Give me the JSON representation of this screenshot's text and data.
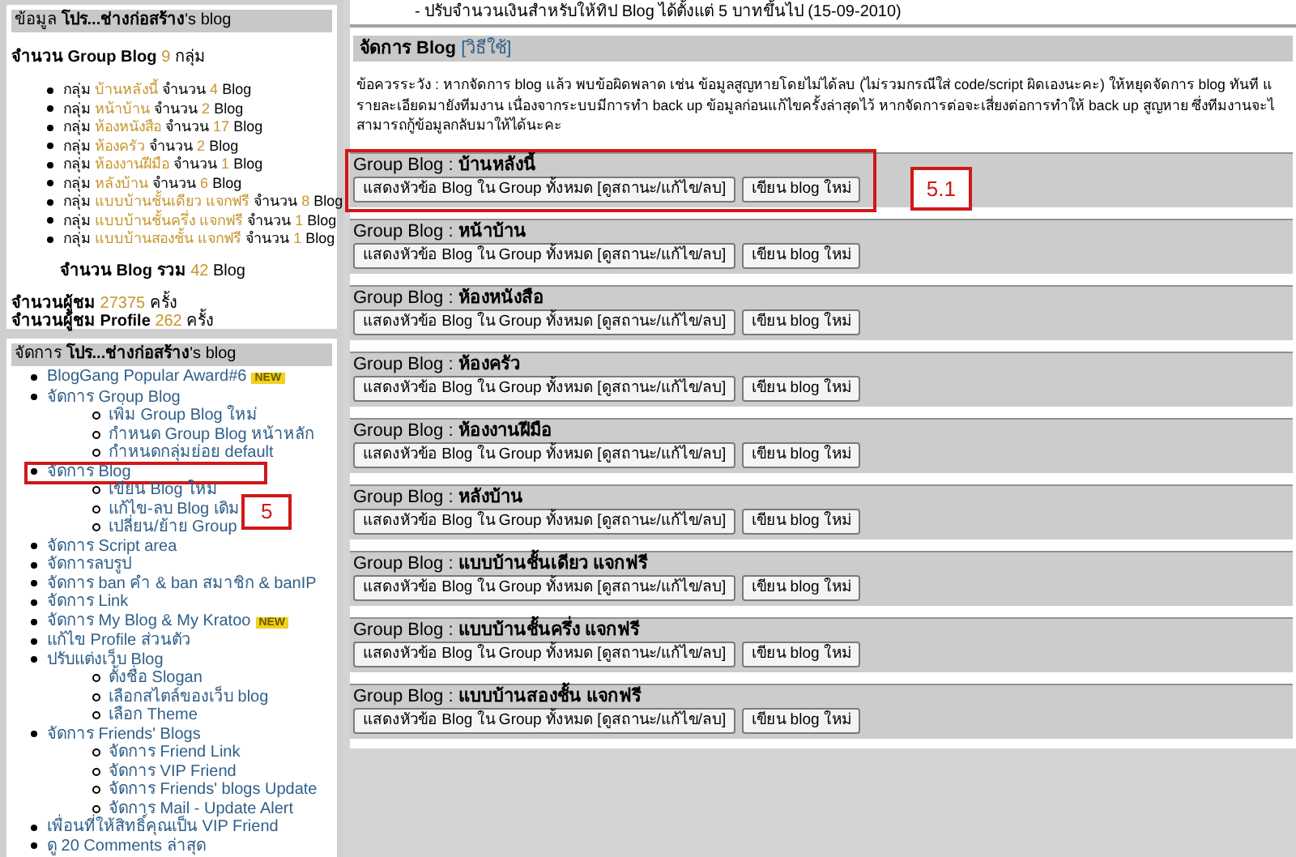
{
  "notice": "- ปรับจำนวนเงินสำหรับให้ทิป Blog ได้ตั้งแต่ 5 บาทขึ้นไป (15-09-2010)",
  "info": {
    "title_prefix": "ข้อมูล",
    "title_name": "โปร...ช่างก่อสร้าง",
    "title_suffix": "'s blog",
    "group_count_label": "จำนวน Group Blog",
    "group_count": "9",
    "group_count_unit": "กลุ่ม",
    "groups": [
      {
        "prefix": "กลุ่ม",
        "name": "บ้านหลังนี้",
        "count_label": "จำนวน",
        "count": "4",
        "unit": "Blog"
      },
      {
        "prefix": "กลุ่ม",
        "name": "หน้าบ้าน",
        "count_label": "จำนวน",
        "count": "2",
        "unit": "Blog"
      },
      {
        "prefix": "กลุ่ม",
        "name": "ห้องหนังสือ",
        "count_label": "จำนวน",
        "count": "17",
        "unit": "Blog"
      },
      {
        "prefix": "กลุ่ม",
        "name": "ห้องครัว",
        "count_label": "จำนวน",
        "count": "2",
        "unit": "Blog"
      },
      {
        "prefix": "กลุ่ม",
        "name": "ห้องงานฝีมือ",
        "count_label": "จำนวน",
        "count": "1",
        "unit": "Blog"
      },
      {
        "prefix": "กลุ่ม",
        "name": "หลังบ้าน",
        "count_label": "จำนวน",
        "count": "6",
        "unit": "Blog"
      },
      {
        "prefix": "กลุ่ม",
        "name": "แบบบ้านชั้นเดียว แจกฟรี",
        "count_label": "จำนวน",
        "count": "8",
        "unit": "Blog"
      },
      {
        "prefix": "กลุ่ม",
        "name": "แบบบ้านชั้นครึ่ง แจกฟรี",
        "count_label": "จำนวน",
        "count": "1",
        "unit": "Blog"
      },
      {
        "prefix": "กลุ่ม",
        "name": "แบบบ้านสองชั้น แจกฟรี",
        "count_label": "จำนวน",
        "count": "1",
        "unit": "Blog"
      }
    ],
    "total_label": "จำนวน Blog รวม",
    "total": "42",
    "total_unit": "Blog",
    "stats": [
      {
        "label": "จำนวนผู้ชม",
        "value": "27375",
        "unit": "ครั้ง"
      },
      {
        "label": "จำนวนผู้ชม Profile",
        "value": "262",
        "unit": "ครั้ง"
      }
    ]
  },
  "manage": {
    "title_prefix": "จัดการ",
    "title_name": "โปร...ช่างก่อสร้าง",
    "title_suffix": "'s blog",
    "items": [
      {
        "label": "BlogGang Popular Award#6",
        "badge": "NEW"
      },
      {
        "label": "จัดการ Group Blog",
        "children": [
          {
            "label": "เพิ่ม Group Blog ใหม่"
          },
          {
            "label": "กำหนด Group Blog หน้าหลัก"
          },
          {
            "label": "กำหนดกลุ่มย่อย default"
          }
        ]
      },
      {
        "label": "จัดการ Blog",
        "annotation": "5",
        "children": [
          {
            "label": "เขียน Blog ใหม่"
          },
          {
            "label": "แก้ไข-ลบ Blog เดิม"
          },
          {
            "label": "เปลี่ยน/ย้าย Group"
          }
        ]
      },
      {
        "label": "จัดการ Script area"
      },
      {
        "label": "จัดการลบรูป"
      },
      {
        "label": "จัดการ ban คำ & ban สมาชิก & banIP"
      },
      {
        "label": "จัดการ Link"
      },
      {
        "label": "จัดการ My Blog & My Kratoo",
        "badge": "NEW"
      },
      {
        "label": "แก้ไข Profile ส่วนตัว"
      },
      {
        "label": "ปรับแต่งเว็บ Blog",
        "children": [
          {
            "label": "ตั้งชื่อ Slogan"
          },
          {
            "label": "เลือกสไตล์ของเว็บ blog"
          },
          {
            "label": "เลือก Theme"
          }
        ]
      },
      {
        "label": "จัดการ Friends' Blogs",
        "children": [
          {
            "label": "จัดการ Friend Link"
          },
          {
            "label": "จัดการ VIP Friend"
          },
          {
            "label": "จัดการ Friends' blogs Update"
          },
          {
            "label": "จัดการ Mail - Update Alert"
          }
        ]
      },
      {
        "label": "เพื่อนที่ให้สิทธิ์คุณเป็น VIP Friend"
      },
      {
        "label": "ดู 20 Comments ล่าสุด"
      }
    ]
  },
  "blog_panel": {
    "title": "จัดการ Blog",
    "help_link": "[วิธีใช้]",
    "warning_lines": [
      "ข้อควรระวัง : หากจัดการ blog แล้ว พบข้อผิดพลาด เช่น ข้อมูลสูญหายโดยไม่ได้ลบ (ไม่รวมกรณีใส่ code/script ผิดเองนะคะ) ให้หยุดจัดการ blog ทันที แ",
      "รายละเอียดมายังทีมงาน เนื่องจากระบบมีการทำ back up ข้อมูลก่อนแก้ไขครั้งล่าสุดไว้ หากจัดการต่อจะเสี่ยงต่อการทำให้ back up สูญหาย ซึ่งทีมงานจะไ",
      "สามารถกู้ข้อมูลกลับมาให้ได้นะคะ"
    ],
    "groups": [
      {
        "label": "Group Blog :",
        "name": "บ้านหลังนี้",
        "annotation": "5.1",
        "buttons": [
          "แสดงหัวข้อ Blog ใน Group ทั้งหมด [ดูสถานะ/แก้ไข/ลบ]",
          "เขียน blog ใหม่"
        ]
      },
      {
        "label": "Group Blog :",
        "name": "หน้าบ้าน",
        "buttons": [
          "แสดงหัวข้อ Blog ใน Group ทั้งหมด [ดูสถานะ/แก้ไข/ลบ]",
          "เขียน blog ใหม่"
        ]
      },
      {
        "label": "Group Blog :",
        "name": "ห้องหนังสือ",
        "buttons": [
          "แสดงหัวข้อ Blog ใน Group ทั้งหมด [ดูสถานะ/แก้ไข/ลบ]",
          "เขียน blog ใหม่"
        ]
      },
      {
        "label": "Group Blog :",
        "name": "ห้องครัว",
        "buttons": [
          "แสดงหัวข้อ Blog ใน Group ทั้งหมด [ดูสถานะ/แก้ไข/ลบ]",
          "เขียน blog ใหม่"
        ]
      },
      {
        "label": "Group Blog :",
        "name": "ห้องงานฝีมือ",
        "buttons": [
          "แสดงหัวข้อ Blog ใน Group ทั้งหมด [ดูสถานะ/แก้ไข/ลบ]",
          "เขียน blog ใหม่"
        ]
      },
      {
        "label": "Group Blog :",
        "name": "หลังบ้าน",
        "buttons": [
          "แสดงหัวข้อ Blog ใน Group ทั้งหมด [ดูสถานะ/แก้ไข/ลบ]",
          "เขียน blog ใหม่"
        ]
      },
      {
        "label": "Group Blog :",
        "name": "แบบบ้านชั้นเดียว แจกฟรี",
        "buttons": [
          "แสดงหัวข้อ Blog ใน Group ทั้งหมด [ดูสถานะ/แก้ไข/ลบ]",
          "เขียน blog ใหม่"
        ]
      },
      {
        "label": "Group Blog :",
        "name": "แบบบ้านชั้นครึ่ง แจกฟรี",
        "buttons": [
          "แสดงหัวข้อ Blog ใน Group ทั้งหมด [ดูสถานะ/แก้ไข/ลบ]",
          "เขียน blog ใหม่"
        ]
      },
      {
        "label": "Group Blog :",
        "name": "แบบบ้านสองชั้น แจกฟรี",
        "buttons": [
          "แสดงหัวข้อ Blog ใน Group ทั้งหมด [ดูสถานะ/แก้ไข/ลบ]",
          "เขียน blog ใหม่"
        ]
      }
    ]
  }
}
